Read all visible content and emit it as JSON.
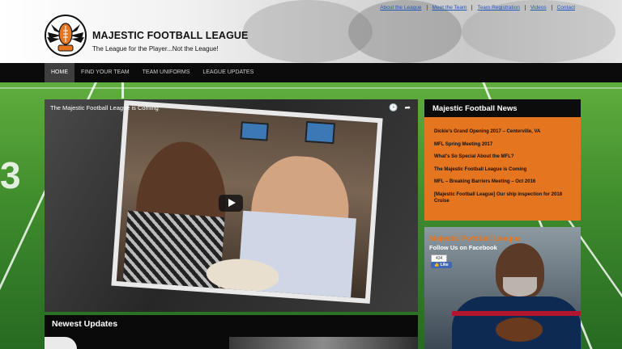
{
  "header": {
    "title": "MAJESTIC FOOTBALL LEAGUE",
    "tagline": "The League for the Player...Not the League!",
    "logo_icon": "football-helmet-wings-logo",
    "links": [
      "About the League",
      "Meet the Team",
      "Team Registration",
      "Videos",
      "Contact"
    ]
  },
  "nav": {
    "items": [
      "HOME",
      "FIND YOUR TEAM",
      "TEAM UNIFORMS",
      "LEAGUE UPDATES"
    ],
    "active": "HOME"
  },
  "video": {
    "title": "The Majestic Football League is Coming",
    "icons": [
      "clock-icon",
      "share-icon",
      "play-icon"
    ]
  },
  "updates": {
    "title": "Newest Updates"
  },
  "news": {
    "title": "Majestic Football News",
    "items": [
      "Dickie's Grand Opening 2017 – Centerville, VA",
      "MFL Spring Meeting 2017",
      "What's So Special About the MFL?",
      "The Majestic Football League is Coming",
      "MFL – Breaking Barriers Meeting – Oct 2016",
      "[Majestic Football League] Our ship inspection for 2018 Cruise"
    ]
  },
  "facebook": {
    "page_name": "Majestic Football League",
    "follow_text": "Follow Us on Facebook",
    "like_count": "434",
    "like_label": "Like"
  },
  "colors": {
    "accent": "#e6751f",
    "nav_bg": "#0b0b0b",
    "link": "#1f57b5",
    "field_green": "#3f8c2d"
  }
}
